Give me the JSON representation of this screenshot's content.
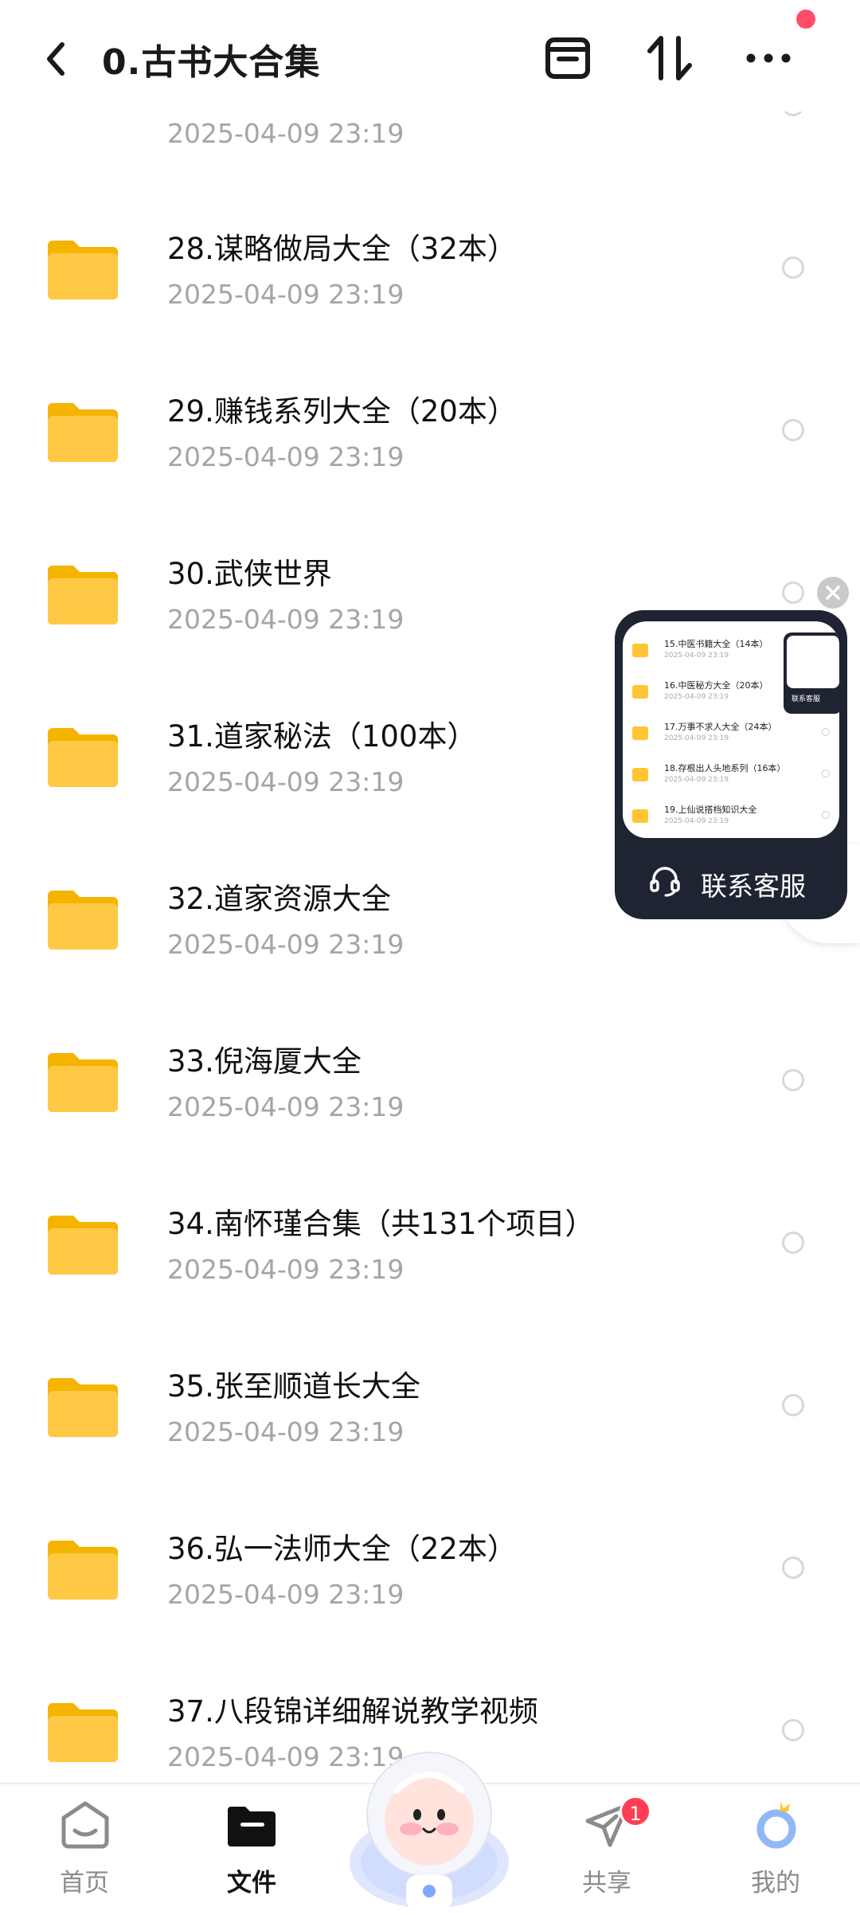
{
  "header": {
    "title": "0.古书大合集",
    "back_icon": "chevron-left-icon",
    "archive_icon": "archive-box-icon",
    "sort_icon": "sort-arrows-icon",
    "more_icon": "more-dots-icon",
    "notification_dot_color": "#ff4d6a"
  },
  "folders": [
    {
      "name": "",
      "date": "2025-04-09  23:19"
    },
    {
      "name": "28.谋略做局大全（32本）",
      "date": "2025-04-09  23:19"
    },
    {
      "name": "29.赚钱系列大全（20本）",
      "date": "2025-04-09  23:19"
    },
    {
      "name": "30.武侠世界",
      "date": "2025-04-09  23:19"
    },
    {
      "name": "31.道家秘法（100本）",
      "date": "2025-04-09  23:19"
    },
    {
      "name": "32.道家资源大全",
      "date": "2025-04-09  23:19"
    },
    {
      "name": "33.倪海厦大全",
      "date": "2025-04-09  23:19"
    },
    {
      "name": "34.南怀瑾合集（共131个项目）",
      "date": "2025-04-09  23:19"
    },
    {
      "name": "35.张至顺道长大全",
      "date": "2025-04-09  23:19"
    },
    {
      "name": "36.弘一法师大全（22本）",
      "date": "2025-04-09  23:19"
    },
    {
      "name": "37.八段锦详细解说教学视频",
      "date": "2025-04-09  23:19"
    }
  ],
  "customer_service": {
    "label": "联系客服",
    "thumb_label": "联系客服",
    "preview_rows": [
      {
        "name": "15.中医书籍大全（14本）",
        "date": "2025-04-09  23:19"
      },
      {
        "name": "16.中医秘方大全（20本）",
        "date": "2025-04-09  23:19"
      },
      {
        "name": "17.万事不求人大全（24本）",
        "date": "2025-04-09  23:19"
      },
      {
        "name": "18.存根出人头地系列（16本）",
        "date": "2025-04-09  23:19"
      },
      {
        "name": "19.上仙说搭档知识大全",
        "date": "2025-04-09  23:19"
      }
    ]
  },
  "bottom_nav": {
    "items": [
      {
        "label": "首页",
        "icon": "home-face-icon"
      },
      {
        "label": "文件",
        "icon": "folder-icon",
        "active": true
      },
      {
        "label": "共享",
        "icon": "paper-plane-icon",
        "badge": "1"
      },
      {
        "label": "我的",
        "icon": "profile-crown-icon"
      }
    ],
    "center_icon": "mascot-astronaut-icon"
  },
  "colors": {
    "folder_yellow": "#ffc533",
    "card_dark": "#1f2433",
    "badge_red": "#ff3e55",
    "date_gray": "#a5a5a5"
  }
}
